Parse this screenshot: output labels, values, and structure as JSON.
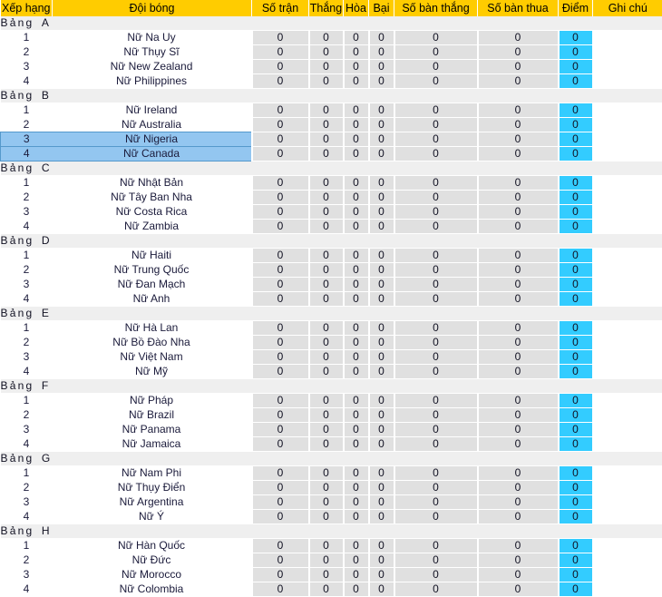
{
  "table": {
    "columns": [
      {
        "key": "rank",
        "label": "Xếp hạng"
      },
      {
        "key": "team",
        "label": "Đội bóng"
      },
      {
        "key": "played",
        "label": "Số trận"
      },
      {
        "key": "win",
        "label": "Thắng"
      },
      {
        "key": "draw",
        "label": "Hòa"
      },
      {
        "key": "loss",
        "label": "Bại"
      },
      {
        "key": "gf",
        "label": "Số bàn thắng"
      },
      {
        "key": "ga",
        "label": "Số bàn thua"
      },
      {
        "key": "pts",
        "label": "Điểm"
      },
      {
        "key": "note",
        "label": "Ghi chú"
      }
    ],
    "group_word": "Bảng",
    "colors": {
      "header_bg": "#FFCC00",
      "group_bg": "#EFEFEF",
      "stat_bg": "#E0E0E0",
      "points_bg": "#33CCFF",
      "highlight_bg": "#93C6F0",
      "row_bg": "#FFFFFF"
    },
    "groups": [
      {
        "letter": "A",
        "rows": [
          {
            "rank": "1",
            "team": "Nữ Na Uy",
            "played": "0",
            "win": "0",
            "draw": "0",
            "loss": "0",
            "gf": "0",
            "ga": "0",
            "pts": "0",
            "note": "",
            "highlight": false
          },
          {
            "rank": "2",
            "team": "Nữ Thụy Sĩ",
            "played": "0",
            "win": "0",
            "draw": "0",
            "loss": "0",
            "gf": "0",
            "ga": "0",
            "pts": "0",
            "note": "",
            "highlight": false
          },
          {
            "rank": "3",
            "team": "Nữ New Zealand",
            "played": "0",
            "win": "0",
            "draw": "0",
            "loss": "0",
            "gf": "0",
            "ga": "0",
            "pts": "0",
            "note": "",
            "highlight": false
          },
          {
            "rank": "4",
            "team": "Nữ Philippines",
            "played": "0",
            "win": "0",
            "draw": "0",
            "loss": "0",
            "gf": "0",
            "ga": "0",
            "pts": "0",
            "note": "",
            "highlight": false
          }
        ]
      },
      {
        "letter": "B",
        "rows": [
          {
            "rank": "1",
            "team": "Nữ Ireland",
            "played": "0",
            "win": "0",
            "draw": "0",
            "loss": "0",
            "gf": "0",
            "ga": "0",
            "pts": "0",
            "note": "",
            "highlight": false
          },
          {
            "rank": "2",
            "team": "Nữ Australia",
            "played": "0",
            "win": "0",
            "draw": "0",
            "loss": "0",
            "gf": "0",
            "ga": "0",
            "pts": "0",
            "note": "",
            "highlight": false
          },
          {
            "rank": "3",
            "team": "Nữ Nigeria",
            "played": "0",
            "win": "0",
            "draw": "0",
            "loss": "0",
            "gf": "0",
            "ga": "0",
            "pts": "0",
            "note": "",
            "highlight": true
          },
          {
            "rank": "4",
            "team": "Nữ Canada",
            "played": "0",
            "win": "0",
            "draw": "0",
            "loss": "0",
            "gf": "0",
            "ga": "0",
            "pts": "0",
            "note": "",
            "highlight": true
          }
        ]
      },
      {
        "letter": "C",
        "rows": [
          {
            "rank": "1",
            "team": "Nữ Nhật Bản",
            "played": "0",
            "win": "0",
            "draw": "0",
            "loss": "0",
            "gf": "0",
            "ga": "0",
            "pts": "0",
            "note": "",
            "highlight": false
          },
          {
            "rank": "2",
            "team": "Nữ Tây Ban Nha",
            "played": "0",
            "win": "0",
            "draw": "0",
            "loss": "0",
            "gf": "0",
            "ga": "0",
            "pts": "0",
            "note": "",
            "highlight": false
          },
          {
            "rank": "3",
            "team": "Nữ Costa Rica",
            "played": "0",
            "win": "0",
            "draw": "0",
            "loss": "0",
            "gf": "0",
            "ga": "0",
            "pts": "0",
            "note": "",
            "highlight": false
          },
          {
            "rank": "4",
            "team": "Nữ Zambia",
            "played": "0",
            "win": "0",
            "draw": "0",
            "loss": "0",
            "gf": "0",
            "ga": "0",
            "pts": "0",
            "note": "",
            "highlight": false
          }
        ]
      },
      {
        "letter": "D",
        "rows": [
          {
            "rank": "1",
            "team": "Nữ Haiti",
            "played": "0",
            "win": "0",
            "draw": "0",
            "loss": "0",
            "gf": "0",
            "ga": "0",
            "pts": "0",
            "note": "",
            "highlight": false
          },
          {
            "rank": "2",
            "team": "Nữ Trung Quốc",
            "played": "0",
            "win": "0",
            "draw": "0",
            "loss": "0",
            "gf": "0",
            "ga": "0",
            "pts": "0",
            "note": "",
            "highlight": false
          },
          {
            "rank": "3",
            "team": "Nữ Đan Mạch",
            "played": "0",
            "win": "0",
            "draw": "0",
            "loss": "0",
            "gf": "0",
            "ga": "0",
            "pts": "0",
            "note": "",
            "highlight": false
          },
          {
            "rank": "4",
            "team": "Nữ Anh",
            "played": "0",
            "win": "0",
            "draw": "0",
            "loss": "0",
            "gf": "0",
            "ga": "0",
            "pts": "0",
            "note": "",
            "highlight": false
          }
        ]
      },
      {
        "letter": "E",
        "rows": [
          {
            "rank": "1",
            "team": "Nữ Hà Lan",
            "played": "0",
            "win": "0",
            "draw": "0",
            "loss": "0",
            "gf": "0",
            "ga": "0",
            "pts": "0",
            "note": "",
            "highlight": false
          },
          {
            "rank": "2",
            "team": "Nữ Bồ Đào Nha",
            "played": "0",
            "win": "0",
            "draw": "0",
            "loss": "0",
            "gf": "0",
            "ga": "0",
            "pts": "0",
            "note": "",
            "highlight": false
          },
          {
            "rank": "3",
            "team": "Nữ Việt Nam",
            "played": "0",
            "win": "0",
            "draw": "0",
            "loss": "0",
            "gf": "0",
            "ga": "0",
            "pts": "0",
            "note": "",
            "highlight": false
          },
          {
            "rank": "4",
            "team": "Nữ Mỹ",
            "played": "0",
            "win": "0",
            "draw": "0",
            "loss": "0",
            "gf": "0",
            "ga": "0",
            "pts": "0",
            "note": "",
            "highlight": false
          }
        ]
      },
      {
        "letter": "F",
        "rows": [
          {
            "rank": "1",
            "team": "Nữ Pháp",
            "played": "0",
            "win": "0",
            "draw": "0",
            "loss": "0",
            "gf": "0",
            "ga": "0",
            "pts": "0",
            "note": "",
            "highlight": false
          },
          {
            "rank": "2",
            "team": "Nữ Brazil",
            "played": "0",
            "win": "0",
            "draw": "0",
            "loss": "0",
            "gf": "0",
            "ga": "0",
            "pts": "0",
            "note": "",
            "highlight": false
          },
          {
            "rank": "3",
            "team": "Nữ Panama",
            "played": "0",
            "win": "0",
            "draw": "0",
            "loss": "0",
            "gf": "0",
            "ga": "0",
            "pts": "0",
            "note": "",
            "highlight": false
          },
          {
            "rank": "4",
            "team": "Nữ Jamaica",
            "played": "0",
            "win": "0",
            "draw": "0",
            "loss": "0",
            "gf": "0",
            "ga": "0",
            "pts": "0",
            "note": "",
            "highlight": false
          }
        ]
      },
      {
        "letter": "G",
        "rows": [
          {
            "rank": "1",
            "team": "Nữ Nam Phi",
            "played": "0",
            "win": "0",
            "draw": "0",
            "loss": "0",
            "gf": "0",
            "ga": "0",
            "pts": "0",
            "note": "",
            "highlight": false
          },
          {
            "rank": "2",
            "team": "Nữ Thụy Điển",
            "played": "0",
            "win": "0",
            "draw": "0",
            "loss": "0",
            "gf": "0",
            "ga": "0",
            "pts": "0",
            "note": "",
            "highlight": false
          },
          {
            "rank": "3",
            "team": "Nữ Argentina",
            "played": "0",
            "win": "0",
            "draw": "0",
            "loss": "0",
            "gf": "0",
            "ga": "0",
            "pts": "0",
            "note": "",
            "highlight": false
          },
          {
            "rank": "4",
            "team": "Nữ Ý",
            "played": "0",
            "win": "0",
            "draw": "0",
            "loss": "0",
            "gf": "0",
            "ga": "0",
            "pts": "0",
            "note": "",
            "highlight": false
          }
        ]
      },
      {
        "letter": "H",
        "rows": [
          {
            "rank": "1",
            "team": "Nữ Hàn Quốc",
            "played": "0",
            "win": "0",
            "draw": "0",
            "loss": "0",
            "gf": "0",
            "ga": "0",
            "pts": "0",
            "note": "",
            "highlight": false
          },
          {
            "rank": "2",
            "team": "Nữ Đức",
            "played": "0",
            "win": "0",
            "draw": "0",
            "loss": "0",
            "gf": "0",
            "ga": "0",
            "pts": "0",
            "note": "",
            "highlight": false
          },
          {
            "rank": "3",
            "team": "Nữ Morocco",
            "played": "0",
            "win": "0",
            "draw": "0",
            "loss": "0",
            "gf": "0",
            "ga": "0",
            "pts": "0",
            "note": "",
            "highlight": false
          },
          {
            "rank": "4",
            "team": "Nữ Colombia",
            "played": "0",
            "win": "0",
            "draw": "0",
            "loss": "0",
            "gf": "0",
            "ga": "0",
            "pts": "0",
            "note": "",
            "highlight": false
          }
        ]
      }
    ]
  }
}
